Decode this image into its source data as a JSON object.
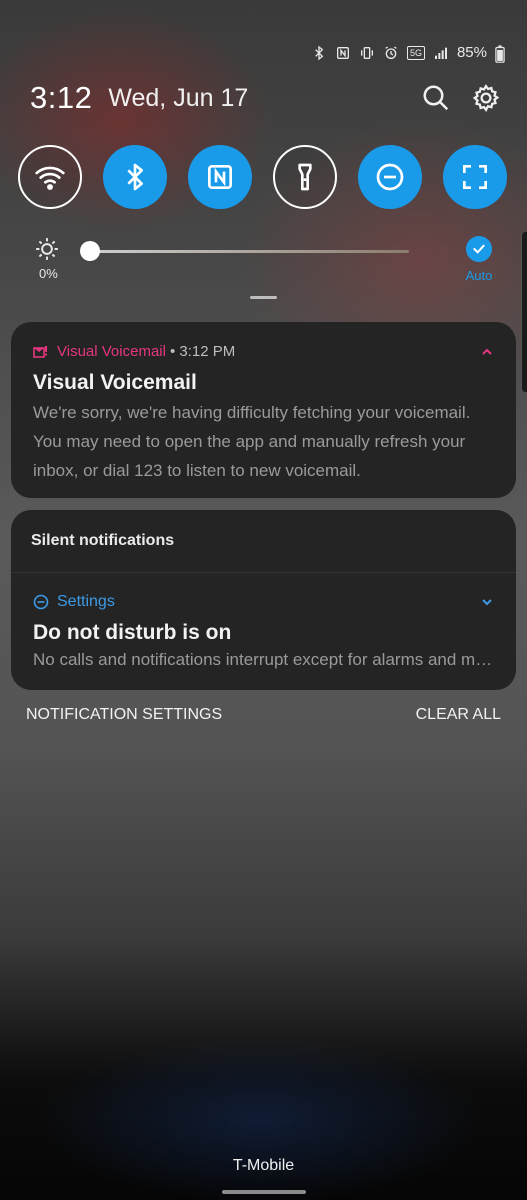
{
  "status_bar": {
    "icons": [
      "bluetooth-icon",
      "nfc-icon",
      "vibrate-icon",
      "alarm-icon",
      "5g-signal-icon",
      "battery-icon"
    ],
    "network_tag": "5G",
    "battery": "85%"
  },
  "header": {
    "time": "3:12",
    "date": "Wed, Jun 17"
  },
  "quick_toggles": [
    {
      "name": "wifi",
      "icon": "wifi-icon",
      "state": "off"
    },
    {
      "name": "bluetooth",
      "icon": "bluetooth-icon",
      "state": "on"
    },
    {
      "name": "nfc",
      "icon": "nfc-icon",
      "state": "on"
    },
    {
      "name": "flashlight",
      "icon": "flashlight-icon",
      "state": "off"
    },
    {
      "name": "do-not-disturb",
      "icon": "dnd-icon",
      "state": "on"
    },
    {
      "name": "screen-capture",
      "icon": "crop-icon",
      "state": "on"
    }
  ],
  "brightness": {
    "percent_label": "0%",
    "level": 0.0,
    "auto_label": "Auto",
    "auto_enabled": true
  },
  "notifications": {
    "voicemail": {
      "app_name": "Visual Voicemail",
      "time": "• 3:12 PM",
      "title": "Visual Voicemail",
      "body": "We're sorry, we're having difficulty fetching your voicemail. You may need to open the app and manually refresh your inbox, or dial 123 to listen to new voicemail."
    },
    "silent": {
      "section_label": "Silent notifications",
      "app_name": "Settings",
      "title": "Do not disturb is on",
      "body": "No calls and notifications interrupt except for alarms and media sounds."
    }
  },
  "actions": {
    "settings_label": "NOTIFICATION SETTINGS",
    "clear_label": "CLEAR ALL"
  },
  "carrier": "T-Mobile",
  "colors": {
    "accent_blue": "#1a9bea",
    "voicemail_pink": "#e4367f",
    "card_bg": "#242424"
  }
}
